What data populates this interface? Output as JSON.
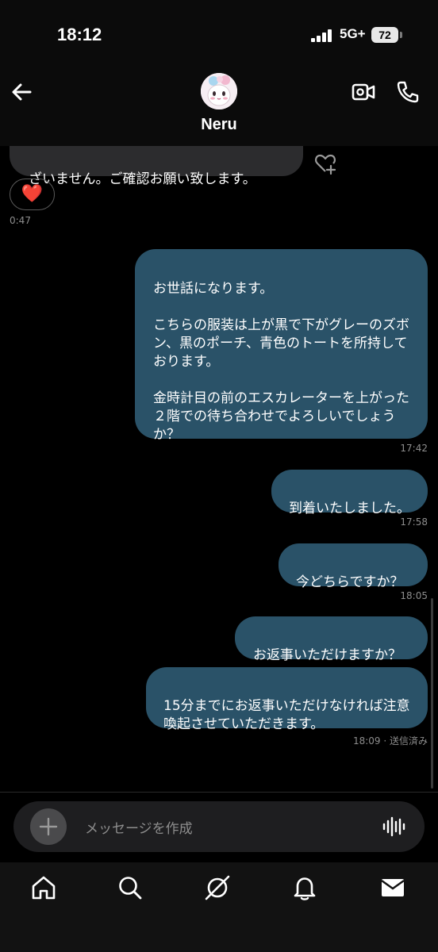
{
  "status_bar": {
    "time": "18:12",
    "network": "5G+",
    "battery": "72"
  },
  "header": {
    "contact_name": "Neru",
    "back_icon": "arrow-left-icon",
    "video_icon": "video-call-icon",
    "phone_icon": "phone-icon"
  },
  "messages": [
    {
      "direction": "incoming",
      "text": "ざいません。ご確認お願い致します。",
      "reaction": "❤️",
      "time": "0:47"
    },
    {
      "direction": "outgoing",
      "text": "お世話になります。\n\nこちらの服装は上が黒で下がグレーのズボン、黒のポーチ、青色のトートを所持しております。\n\n金時計目の前のエスカレーターを上がった２階での待ち合わせでよろしいでしょうか？",
      "time": "17:42"
    },
    {
      "direction": "outgoing",
      "text": "到着いたしました。",
      "time": "17:58"
    },
    {
      "direction": "outgoing",
      "text": "今どちらですか？",
      "time": "18:05"
    },
    {
      "direction": "outgoing",
      "text": "お返事いただけますか？",
      "time": ""
    },
    {
      "direction": "outgoing",
      "text": "15分までにお返事いただけなければ注意喚起させていただきます。",
      "time": "18:09 · 送信済み"
    }
  ],
  "composer": {
    "placeholder": "メッセージを作成"
  },
  "nav": [
    "home-icon",
    "search-icon",
    "grok-icon",
    "notifications-bell-icon",
    "messages-envelope-icon"
  ],
  "colors": {
    "outgoing_bubble": "#2a5268",
    "incoming_bubble": "#2c2c2e",
    "background": "#000000"
  }
}
